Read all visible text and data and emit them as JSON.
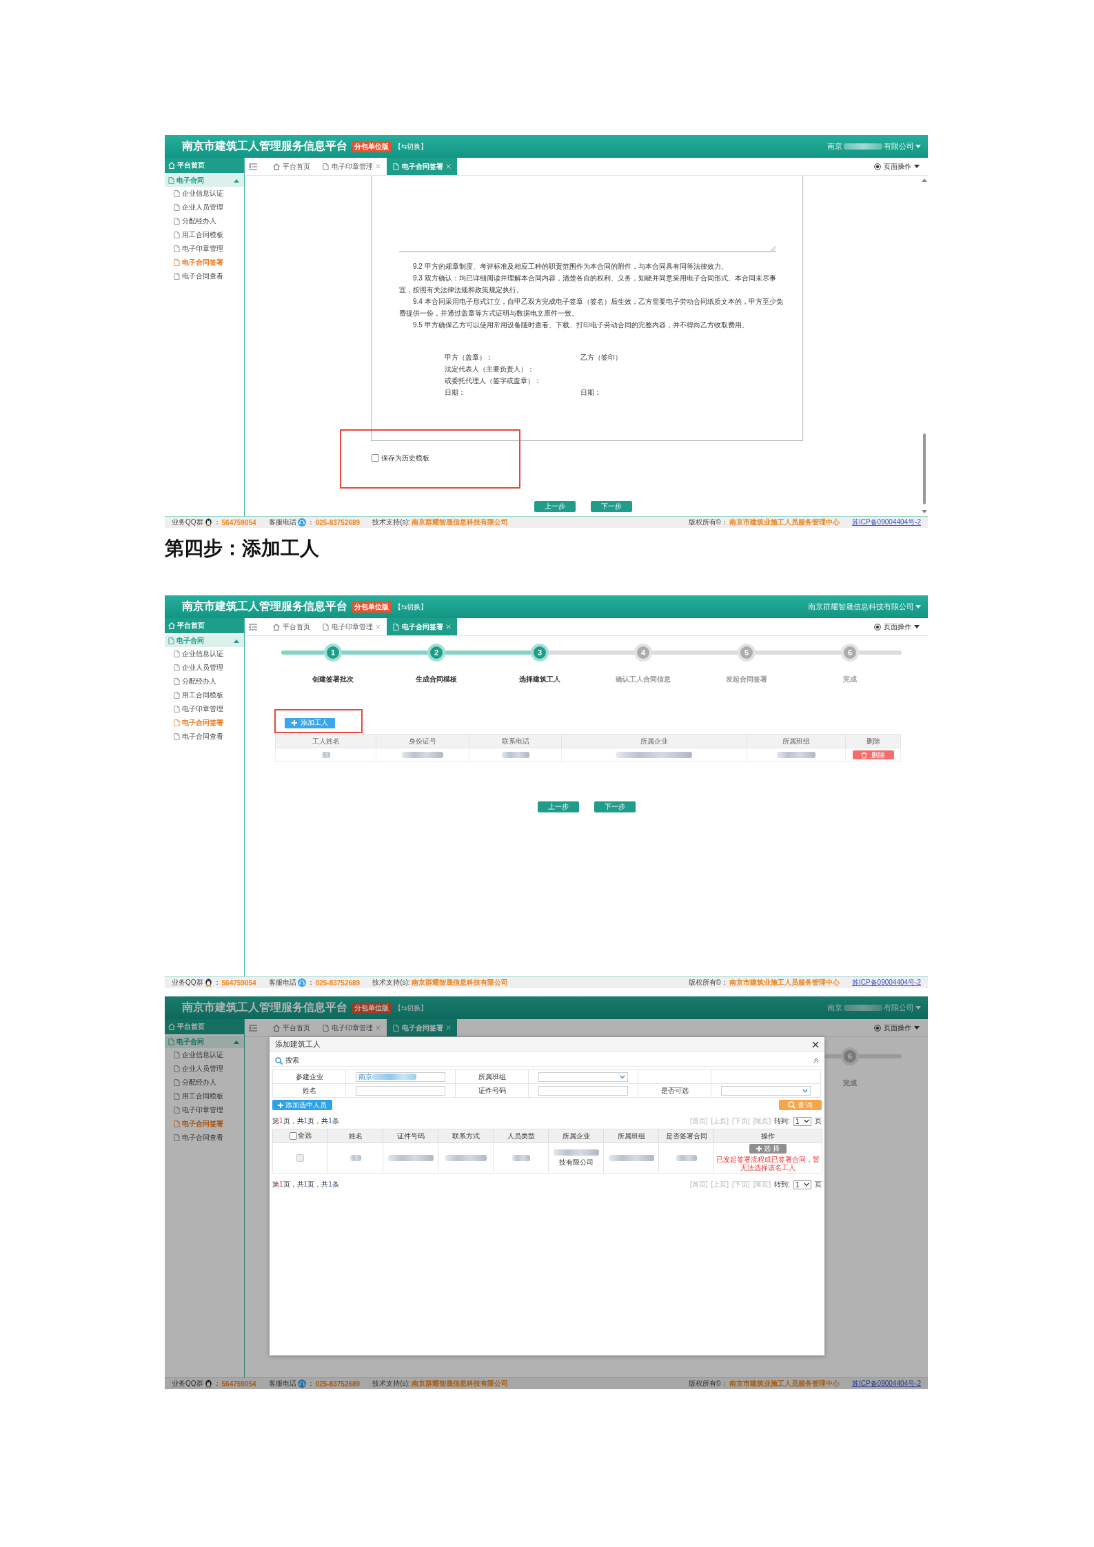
{
  "blocks": [
    {
      "kind": "app-screenshot",
      "header": {
        "title": "南京市建筑工人管理服务信息平台",
        "edition": "分包单位版",
        "switch": "【⇆切换】",
        "company_parts": [
          "南京",
          "有限公司"
        ]
      },
      "sidebar": {
        "home": "平台首页",
        "group": {
          "label": "电子合同",
          "expanded": true,
          "items": [
            {
              "label": "企业信息认证",
              "selected": false
            },
            {
              "label": "企业人员管理",
              "selected": false
            },
            {
              "label": "分配经办人",
              "selected": false
            },
            {
              "label": "用工合同模板",
              "selected": false
            },
            {
              "label": "电子印章管理",
              "selected": false
            },
            {
              "label": "电子合同签署",
              "selected": true
            },
            {
              "label": "电子合同查看",
              "selected": false
            }
          ]
        }
      },
      "tabs": [
        {
          "kind": "home",
          "label": "平台首页",
          "closable": false,
          "selected": false
        },
        {
          "kind": "page",
          "label": "电子印章管理",
          "closable": true,
          "selected": false
        },
        {
          "kind": "page",
          "label": "电子合同签署",
          "closable": true,
          "selected": true
        }
      ],
      "page_menu": "页面操作",
      "content": {
        "kind": "contract-preview",
        "clauses": [
          "9.2 甲方的规章制度、考评标准及相应工种的职责范围作为本合同的附件，与本合同具有同等法律效力。",
          "9.3 双方确认：均已详细阅读并理解本合同内容，清楚各自的权利、义务，知晓并同意采用电子合同形式。本合同未尽事宜，按照有关法律法规和政策规定执行。",
          "9.4 本合同采用电子形式订立，自甲乙双方完成电子签章（签名）后生效，乙方需要电子劳动合同纸质文本的，甲方至少免费提供一份，并通过盖章等方式证明与数据电文原件一致。",
          "9.5 甲方确保乙方可以使用常用设备随时查看、下载、打印电子劳动合同的完整内容，并不得向乙方收取费用。"
        ],
        "signatures": [
          {
            "left": "甲方（盖章）：",
            "right": "乙方（签印）"
          },
          {
            "left": "法定代表人（主要负责人）："
          },
          {
            "left": "或委托代理人（签字或盖章）："
          },
          {
            "left": "日期：",
            "right": "日期："
          }
        ],
        "save_template": {
          "label": "保存为历史模板",
          "checked": false,
          "highlighted": true
        },
        "buttons": [
          "上一步",
          "下一步"
        ]
      },
      "footer": {
        "left": [
          {
            "kind": "qq",
            "label": "业务QQ群",
            "colon": "：",
            "value": "564759054"
          },
          {
            "kind": "phone",
            "label": "客服电话",
            "colon": "：",
            "value": "025-83752689"
          },
          {
            "kind": "text",
            "label": "技术支持(s):",
            "value": "南京群耀智晟信息科技有限公司"
          }
        ],
        "right": [
          {
            "kind": "text",
            "label": "版权所有©：",
            "value": "南京市建筑业施工人员服务管理中心"
          }
        ],
        "icp": "苏ICP备09004404号-2"
      }
    },
    {
      "kind": "heading",
      "text": "第四步：添加工人"
    },
    {
      "kind": "app-screenshot",
      "header": {
        "title": "南京市建筑工人管理服务信息平台",
        "edition": "分包单位版",
        "switch": "【⇆切换】",
        "company_parts": [
          "南京群耀智晟信息科技有限公司"
        ]
      },
      "sidebar": {
        "home": "平台首页",
        "group": {
          "label": "电子合同",
          "expanded": true,
          "items": [
            {
              "label": "企业信息认证",
              "selected": false
            },
            {
              "label": "企业人员管理",
              "selected": false
            },
            {
              "label": "分配经办人",
              "selected": false
            },
            {
              "label": "用工合同模板",
              "selected": false
            },
            {
              "label": "电子印章管理",
              "selected": false
            },
            {
              "label": "电子合同签署",
              "selected": true
            },
            {
              "label": "电子合同查看",
              "selected": false
            }
          ]
        }
      },
      "tabs": [
        {
          "kind": "home",
          "label": "平台首页",
          "closable": false,
          "selected": false
        },
        {
          "kind": "page",
          "label": "电子印章管理",
          "closable": true,
          "selected": false
        },
        {
          "kind": "page",
          "label": "电子合同签署",
          "closable": true,
          "selected": true
        }
      ],
      "page_menu": "页面操作",
      "content": {
        "kind": "step-wizard",
        "steps": [
          {
            "number": "1",
            "label": "创建签署批次",
            "active": true
          },
          {
            "number": "2",
            "label": "生成合同模板",
            "active": true
          },
          {
            "number": "3",
            "label": "选择建筑工人",
            "active": true
          },
          {
            "number": "4",
            "label": "确认工人合同信息",
            "active": false
          },
          {
            "number": "5",
            "label": "发起合同签署",
            "active": false
          },
          {
            "number": "6",
            "label": "完成",
            "active": false
          }
        ],
        "add_button": {
          "label": "添加工人",
          "highlighted": true
        },
        "table": {
          "columns": [
            "工人姓名",
            "身份证号",
            "联系电话",
            "所属企业",
            "所属班组",
            "删除"
          ],
          "rows": [
            {
              "cells": [
                {
                  "redacted": true
                },
                {
                  "redacted": true
                },
                {
                  "redacted": true
                },
                {
                  "redacted": true
                },
                {
                  "redacted": true
                }
              ],
              "delete": "删除"
            }
          ]
        },
        "buttons": [
          "上一步",
          "下一步"
        ]
      },
      "footer": {
        "left": [
          {
            "kind": "qq",
            "label": "业务QQ群",
            "colon": "：",
            "value": "564759054"
          },
          {
            "kind": "phone",
            "label": "客服电话",
            "colon": "：",
            "value": "025-83752689"
          },
          {
            "kind": "text",
            "label": "技术支持(s):",
            "value": "南京群耀智晟信息科技有限公司"
          }
        ],
        "right": [
          {
            "kind": "text",
            "label": "版权所有©：",
            "value": "南京市建筑业施工人员服务管理中心"
          }
        ],
        "icp": "苏ICP备09004404号-2"
      }
    },
    {
      "kind": "app-screenshot",
      "header": {
        "title": "南京市建筑工人管理服务信息平台",
        "edition": "分包单位版",
        "switch": "【⇆切换】",
        "company_parts": [
          "南京",
          "有限公司"
        ]
      },
      "sidebar": {
        "home": "平台首页",
        "group": {
          "label": "电子合同",
          "expanded": true,
          "items": [
            {
              "label": "企业信息认证",
              "selected": false
            },
            {
              "label": "企业人员管理",
              "selected": false
            },
            {
              "label": "分配经办人",
              "selected": false
            },
            {
              "label": "用工合同模板",
              "selected": false
            },
            {
              "label": "电子印章管理",
              "selected": false
            },
            {
              "label": "电子合同签署",
              "selected": true
            },
            {
              "label": "电子合同查看",
              "selected": false
            }
          ]
        }
      },
      "tabs": [
        {
          "kind": "home",
          "label": "平台首页",
          "closable": false,
          "selected": false
        },
        {
          "kind": "page",
          "label": "电子印章管理",
          "closable": true,
          "selected": false
        },
        {
          "kind": "page",
          "label": "电子合同签署",
          "closable": true,
          "selected": true
        }
      ],
      "page_menu": "页面操作",
      "content": {
        "kind": "dialog",
        "background_steps": [
          {
            "number": "6",
            "label": "完成",
            "active": false
          }
        ],
        "dialog": {
          "title": "添加建筑工人",
          "search": "搜索",
          "form": [
            [
              {
                "label": "参建企业",
                "kind": "input",
                "value": "南京",
                "redacted": true
              },
              {
                "label": "所属班组",
                "kind": "select"
              }
            ],
            [
              {
                "label": "姓名",
                "kind": "input"
              },
              {
                "label": "证件号码",
                "kind": "input"
              },
              {
                "label": "是否可选",
                "kind": "select"
              }
            ]
          ],
          "add_selected": "添加选中人员",
          "query": "查 询",
          "pagination_top": {
            "summary": [
              {
                "kind": "plain",
                "text": "第"
              },
              {
                "kind": "current",
                "text": "1"
              },
              {
                "kind": "plain",
                "text": "页，共"
              },
              {
                "kind": "count",
                "text": "1"
              },
              {
                "kind": "plain",
                "text": "页，共"
              },
              {
                "kind": "count",
                "text": "1"
              },
              {
                "kind": "plain",
                "text": "条"
              }
            ],
            "links": [
              {
                "label": "[首页]",
                "disabled": true
              },
              {
                "label": "[上页]",
                "disabled": true
              },
              {
                "label": "[下页]",
                "disabled": true
              },
              {
                "label": "[尾页]",
                "disabled": true
              }
            ],
            "goto": "转到:",
            "page": "1",
            "suffix": "页"
          },
          "table": {
            "select_all": {
              "label": "全选",
              "checked": false
            },
            "columns": [
              "姓名",
              "证件号码",
              "联系方式",
              "人员类型",
              "所属企业",
              "所属班组",
              "是否签署合同",
              "操作"
            ],
            "rows": [
              {
                "checked": false,
                "disabled": true,
                "cells": [
                  {
                    "redacted": true
                  },
                  {
                    "redacted": true
                  },
                  {
                    "redacted": true
                  },
                  {
                    "redacted": true
                  },
                  {
                    "redacted": true,
                    "text": "技有限公司"
                  },
                  {
                    "redacted": true
                  },
                  {
                    "redacted": true
                  }
                ],
                "action": {
                  "label": "选 择",
                  "disabled": true
                },
                "notice": "已发起签署流程或已签署合同，暂无法选择该名工人"
              }
            ]
          },
          "pagination_bottom": {
            "summary": [
              {
                "kind": "plain",
                "text": "第"
              },
              {
                "kind": "current",
                "text": "1"
              },
              {
                "kind": "plain",
                "text": "页，共"
              },
              {
                "kind": "count",
                "text": "1"
              },
              {
                "kind": "plain",
                "text": "页，共"
              },
              {
                "kind": "count",
                "text": "1"
              },
              {
                "kind": "plain",
                "text": "条"
              }
            ],
            "links": [
              {
                "label": "[首页]",
                "disabled": true
              },
              {
                "label": "[上页]",
                "disabled": true
              },
              {
                "label": "[下页]",
                "disabled": true
              },
              {
                "label": "[尾页]",
                "disabled": true
              }
            ],
            "goto": "转到:",
            "page": "1",
            "suffix": "页"
          }
        }
      },
      "footer": {
        "left": [
          {
            "kind": "qq",
            "label": "业务QQ群",
            "colon": "：",
            "value": "564759054"
          },
          {
            "kind": "phone",
            "label": "客服电话",
            "colon": "：",
            "value": "025-83752689"
          },
          {
            "kind": "text",
            "label": "技术支持(s):",
            "value": "南京群耀智晟信息科技有限公司"
          }
        ],
        "right": [
          {
            "kind": "text",
            "label": "版权所有©：",
            "value": "南京市建筑业施工人员服务管理中心"
          }
        ],
        "icp": "苏ICP备09004404号-2"
      }
    }
  ]
}
